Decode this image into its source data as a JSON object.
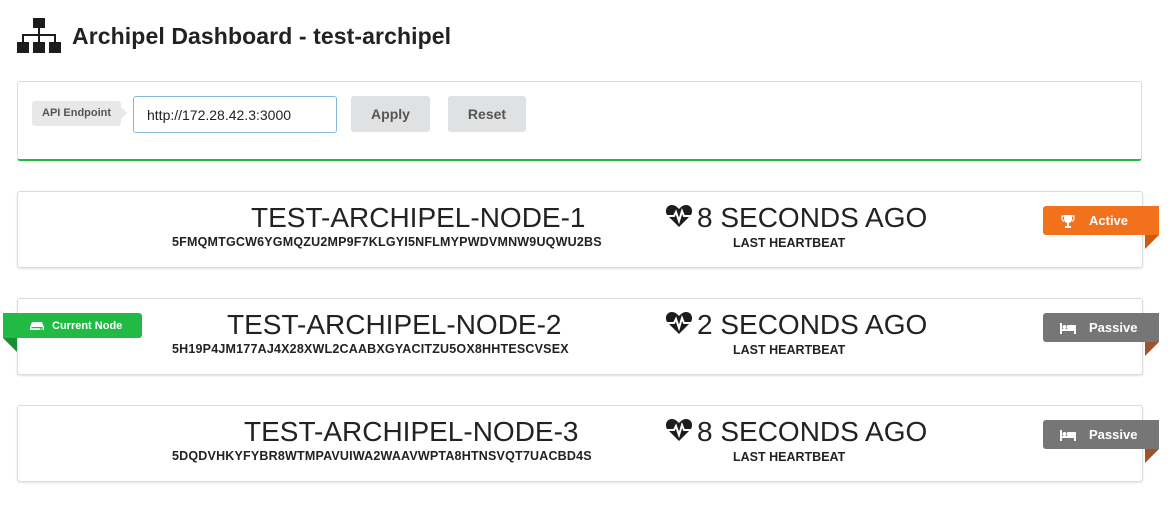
{
  "header": {
    "title": "Archipel Dashboard - test-archipel",
    "icon": "sitemap-icon"
  },
  "endpoint": {
    "label": "API Endpoint",
    "value": "http://172.28.42.3:3000",
    "apply_label": "Apply",
    "reset_label": "Reset",
    "accent_color": "#21ba45"
  },
  "heartbeat_label": "LAST HEARTBEAT",
  "current_node_label": "Current Node",
  "nodes": [
    {
      "name": "TEST-ARCHIPEL-NODE-1",
      "id": "5FMQMTGCW6YGMQZU2MP9F7KLGYI5NFLMYPWDVMNW9UQWU2BS",
      "heartbeat": "8 SECONDS AGO",
      "status": "Active",
      "status_icon": "trophy-icon",
      "status_color": "#f2711c"
    },
    {
      "name": "TEST-ARCHIPEL-NODE-2",
      "id": "5H19P4JM177AJ4X28XWL2CAABXGYACITZU5OX8HHTESCVSEX",
      "heartbeat": "2 SECONDS AGO",
      "status": "Passive",
      "status_icon": "bed-icon",
      "status_color": "#767676",
      "current": true
    },
    {
      "name": "TEST-ARCHIPEL-NODE-3",
      "id": "5DQDVHKYFYBR8WTMPAVUIWA2WAAVWPTA8HTNSVQT7UACBD4S",
      "heartbeat": "8 SECONDS AGO",
      "status": "Passive",
      "status_icon": "bed-icon",
      "status_color": "#767676"
    }
  ]
}
